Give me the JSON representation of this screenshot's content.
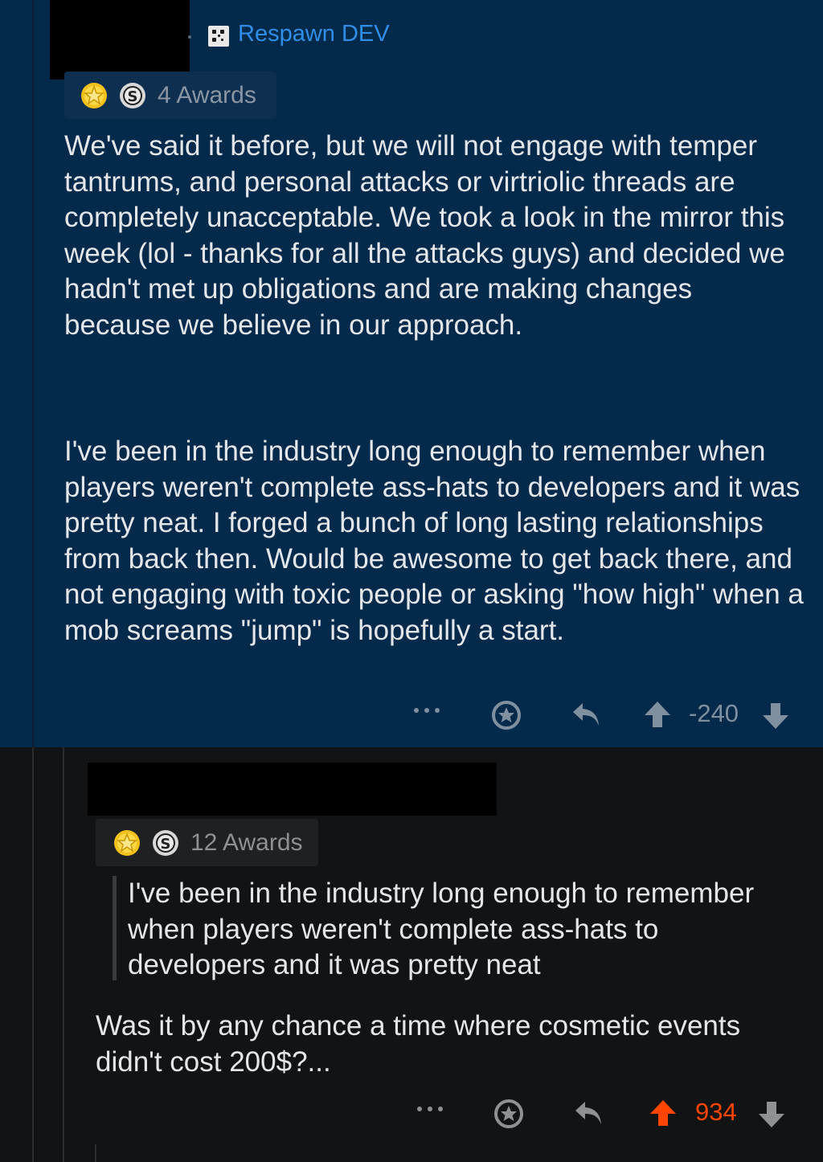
{
  "parent_comment": {
    "flair": {
      "text": "Respawn DEV",
      "icon": "respawn-flair-icon"
    },
    "awards": {
      "count_label": "4 Awards",
      "icons": [
        "gold-star-award-icon",
        "silver-coin-award-icon"
      ]
    },
    "paragraphs": [
      "We've said it before, but we will not engage with temper tantrums, and personal attacks or virtriolic threads are completely unacceptable. We took a look in the mirror this week (lol - thanks for all the attacks guys) and decided we hadn't met up obligations and are making changes because we believe in our approach.",
      "I've been in the industry long enough to remember when players weren't complete ass-hats to developers and it was pretty neat. I forged a bunch of long lasting relationships from back then. Would be awesome to get back there, and not engaging with toxic people or asking \"how high\" when a mob screams \"jump\" is hopefully a start."
    ],
    "actions": {
      "score": "-240",
      "score_color": "#8190a1"
    }
  },
  "child_comment": {
    "awards": {
      "count_label": "12 Awards",
      "icons": [
        "gold-star-award-icon",
        "silver-coin-award-icon"
      ]
    },
    "quote": "I've been in the industry long enough to remember when players weren't complete ass-hats to developers and it was pretty neat",
    "text": "Was it by any chance a time where cosmetic events didn't cost 200$?...",
    "actions": {
      "score": "934",
      "score_color": "#ff4500"
    }
  },
  "colors": {
    "highlight_bg": "#042a4b",
    "page_bg": "#121315",
    "flair_text": "#2f8fe8",
    "upvote_active": "#ff4500"
  }
}
